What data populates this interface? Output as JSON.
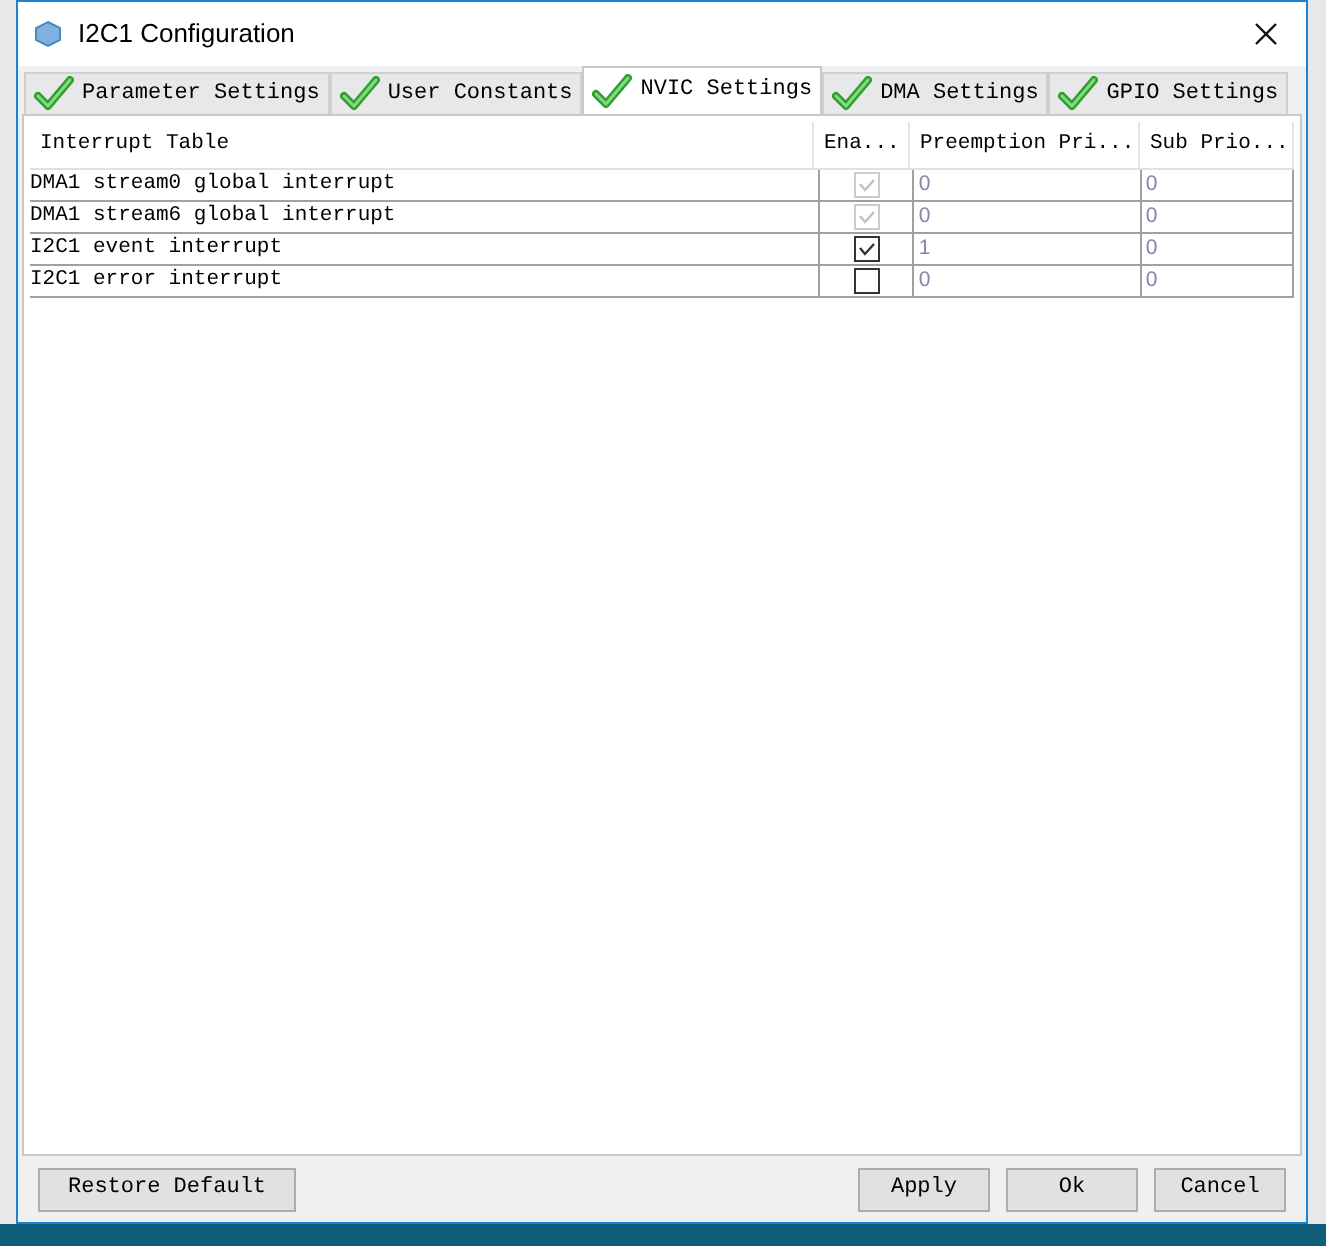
{
  "window": {
    "title": "I2C1 Configuration"
  },
  "tabs": [
    {
      "label": "Parameter Settings",
      "selected": false
    },
    {
      "label": "User Constants",
      "selected": false
    },
    {
      "label": "NVIC Settings",
      "selected": true
    },
    {
      "label": "DMA Settings",
      "selected": false
    },
    {
      "label": "GPIO Settings",
      "selected": false
    }
  ],
  "table": {
    "columns": [
      "Interrupt Table",
      "Ena...",
      "Preemption Pri...",
      "Sub Prio..."
    ],
    "rows": [
      {
        "name": "DMA1 stream0 global interrupt",
        "checked": true,
        "disabled": true,
        "preemption": "0",
        "sub": "0"
      },
      {
        "name": "DMA1 stream6 global interrupt",
        "checked": true,
        "disabled": true,
        "preemption": "0",
        "sub": "0"
      },
      {
        "name": "I2C1 event interrupt",
        "checked": true,
        "disabled": false,
        "preemption": "1",
        "sub": "0"
      },
      {
        "name": "I2C1 error interrupt",
        "checked": false,
        "disabled": false,
        "preemption": "0",
        "sub": "0"
      }
    ]
  },
  "buttons": {
    "left": [
      "Restore Default"
    ],
    "right": [
      "Apply",
      "Ok",
      "Cancel"
    ]
  }
}
